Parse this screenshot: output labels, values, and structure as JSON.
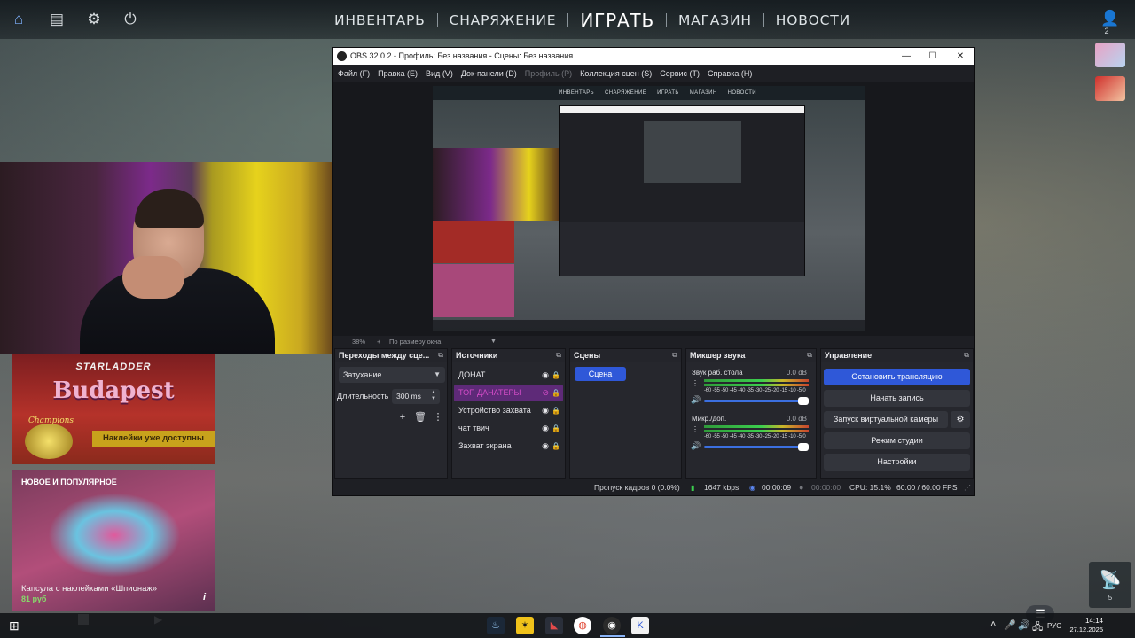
{
  "cs": {
    "nav": [
      "ИНВЕНТАРЬ",
      "СНАРЯЖЕНИЕ",
      "ИГРАТЬ",
      "МАГАЗИН",
      "НОВОСТИ"
    ],
    "active_nav": "ИГРАТЬ",
    "user_count": "2",
    "promo": {
      "brand": "STARLADDER",
      "title": "Budapest",
      "subtitle": "Champions",
      "banner": "Наклейки уже доступны"
    },
    "capsule": {
      "tag": "НОВОЕ И ПОПУЛЯРНОЕ",
      "name": "Капсула с наклейками «Шпионаж»",
      "price": "81 руб",
      "info": "i"
    },
    "antenna_count": "5"
  },
  "obs": {
    "title": "OBS 32.0.2 - Профиль: Без названия - Сцены: Без названия",
    "menu": [
      "Файл (F)",
      "Правка (E)",
      "Вид (V)",
      "Док-панели (D)",
      "Профиль (P)",
      "Коллекция сцен (S)",
      "Сервис (T)",
      "Справка (H)"
    ],
    "preview_nav": [
      "ИНВЕНТАРЬ",
      "СНАРЯЖЕНИЕ",
      "ИГРАТЬ",
      "МАГАЗИН",
      "НОВОСТИ"
    ],
    "zoom": "38%",
    "zoom_mode": "По размеру окна",
    "docks": {
      "transitions": {
        "title": "Переходы между сце...",
        "selected": "Затухание",
        "duration_label": "Длительность",
        "duration": "300 ms"
      },
      "sources": {
        "title": "Источники",
        "items": [
          "ДОНАТ",
          "ТОП ДАНАТЕРЫ",
          "Устройство захвата",
          "чат твич",
          "Захват экрана"
        ],
        "selected": "ТОП ДАНАТЕРЫ"
      },
      "scenes": {
        "title": "Сцены",
        "items": [
          "Сцена"
        ]
      },
      "mixer": {
        "title": "Микшер звука",
        "channels": [
          {
            "name": "Звук раб. стола",
            "db": "0.0 dB"
          },
          {
            "name": "Микр./доп.",
            "db": "0.0 dB"
          }
        ],
        "scale": "-60 -55 -50 -45 -40 -35 -30 -25 -20 -15 -10 -5 0"
      },
      "controls": {
        "title": "Управление",
        "stop_stream": "Остановить трансляцию",
        "start_record": "Начать запись",
        "virtual_cam": "Запуск виртуальной камеры",
        "studio_mode": "Режим студии",
        "settings": "Настройки"
      }
    },
    "status": {
      "dropped": "Пропуск кадров 0 (0.0%)",
      "bitrate": "1647 kbps",
      "stream_time": "00:00:09",
      "record_time": "00:00:00",
      "cpu": "CPU: 15.1%",
      "fps": "60.00 / 60.00 FPS"
    }
  },
  "taskbar": {
    "lang": "РУС",
    "time": "14:14",
    "date": "27.12.2025"
  },
  "colors": {
    "obs_accent": "#2f58d8",
    "source_selected": "#d44cc8",
    "meter_green": "#3ccf4e"
  }
}
